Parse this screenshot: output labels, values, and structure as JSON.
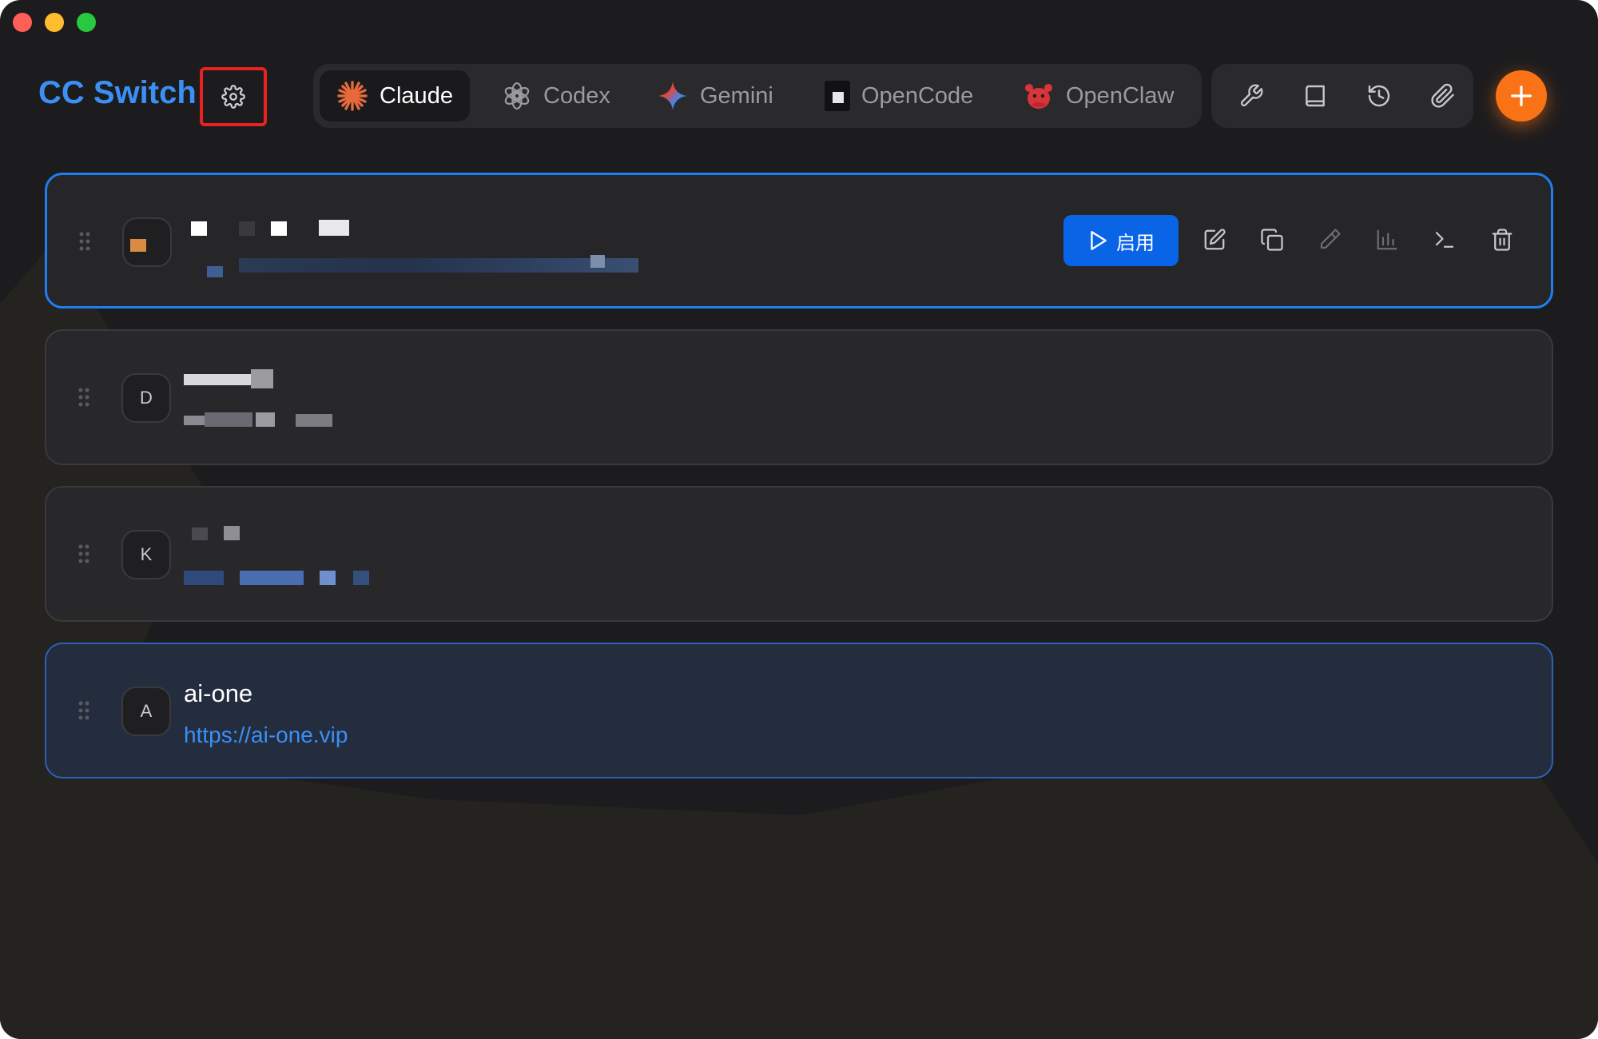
{
  "app": {
    "title": "CC Switch",
    "accent": "#3b8ff5"
  },
  "header": {
    "settings_icon": "gear-icon",
    "app_tabs": [
      {
        "label": "Claude",
        "icon": "claude-starburst-icon",
        "active": true
      },
      {
        "label": "Codex",
        "icon": "openai-knot-icon",
        "active": false
      },
      {
        "label": "Gemini",
        "icon": "gemini-sparkle-icon",
        "active": false
      },
      {
        "label": "OpenCode",
        "icon": "opencode-square-icon",
        "active": false
      },
      {
        "label": "OpenClaw",
        "icon": "openclaw-crab-icon",
        "active": false
      }
    ],
    "tools": [
      "wrench-icon",
      "book-icon",
      "history-icon",
      "paperclip-icon"
    ],
    "add_icon": "plus-icon",
    "add_color": "#f97316"
  },
  "providers": [
    {
      "title": "",
      "url": "",
      "avatar": "",
      "state": "selected",
      "actions": {
        "enable_label": "启用",
        "icons": [
          "edit-icon",
          "copy-icon",
          "test-icon",
          "usage-chart-icon",
          "terminal-icon",
          "trash-icon"
        ]
      }
    },
    {
      "title": "",
      "url": "",
      "avatar": "D",
      "state": "normal"
    },
    {
      "title": "",
      "url": "",
      "avatar": "K",
      "state": "normal"
    },
    {
      "title": "ai-one",
      "url": "https://ai-one.vip",
      "avatar": "A",
      "state": "hover"
    }
  ]
}
